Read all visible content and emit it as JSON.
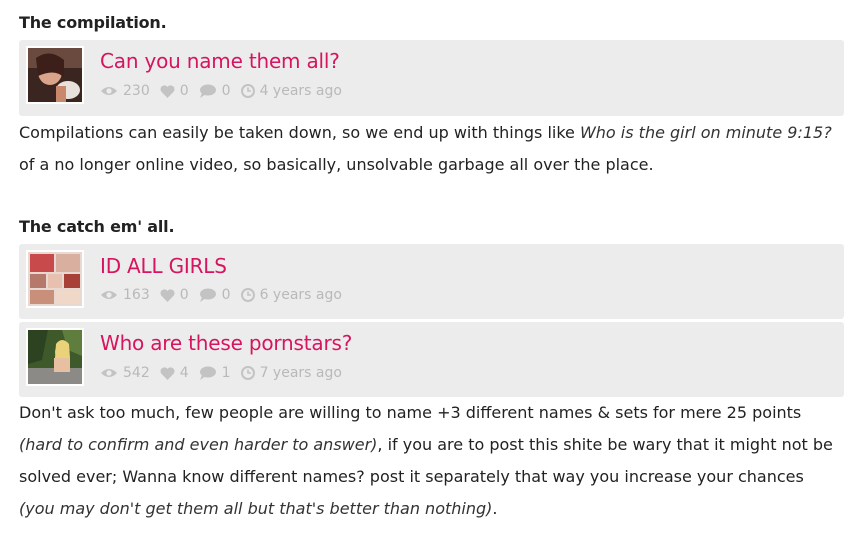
{
  "section1": {
    "heading": "The compilation.",
    "card": {
      "title": "Can you name them all?",
      "views": "230",
      "likes": "0",
      "comments": "0",
      "time": "4 years ago"
    },
    "para": {
      "t1": "Compilations can easily be taken down, so we end up with things like ",
      "i1": "Who is the girl on minute 9:15?",
      "t2": " of a no longer online video, so basically, unsolvable garbage all over the place."
    }
  },
  "section2": {
    "heading": "The catch em' all.",
    "cards": [
      {
        "title": "ID ALL GIRLS",
        "views": "163",
        "likes": "0",
        "comments": "0",
        "time": "6 years ago"
      },
      {
        "title": "Who are these pornstars?",
        "views": "542",
        "likes": "4",
        "comments": "1",
        "time": "7 years ago"
      }
    ],
    "para": {
      "t1": "Don't ask too much, few people are willing to name +3 different names & sets for mere 25 points ",
      "i1": "(hard to confirm and even harder to answer)",
      "t2": ", if you are to post this shite be wary that it might not be solved ever; Wanna know different names? post it separately that way you increase your chances ",
      "i2": "(you may don't get them all but that's better than nothing)",
      "t3": "."
    }
  },
  "icons": [
    "eye-icon",
    "heart-icon",
    "comment-icon",
    "clock-icon"
  ],
  "colors": {
    "title": "#d6145f",
    "meta": "#b9b9b9",
    "card_bg": "#ececec"
  }
}
